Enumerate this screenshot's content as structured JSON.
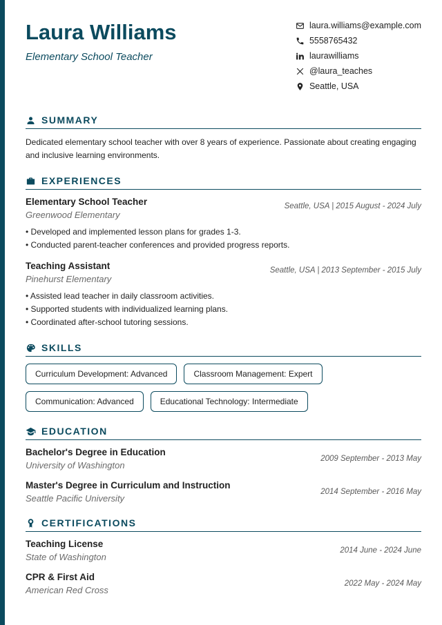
{
  "name": "Laura Williams",
  "title": "Elementary School Teacher",
  "contacts": {
    "email": "laura.williams@example.com",
    "phone": "5558765432",
    "linkedin": "laurawilliams",
    "twitter": "@laura_teaches",
    "location": "Seattle, USA"
  },
  "sections": {
    "summary": "SUMMARY",
    "experiences": "EXPERIENCES",
    "skills": "SKILLS",
    "education": "EDUCATION",
    "certifications": "CERTIFICATIONS"
  },
  "summary": "Dedicated elementary school teacher with over 8 years of experience. Passionate about creating engaging and inclusive learning environments.",
  "experiences": [
    {
      "title": "Elementary School Teacher",
      "org": "Greenwood Elementary",
      "meta": "Seattle, USA  |  2015 August - 2024 July",
      "bullets": [
        "• Developed and implemented lesson plans for grades 1-3.",
        "• Conducted parent-teacher conferences and provided progress reports."
      ]
    },
    {
      "title": "Teaching Assistant",
      "org": "Pinehurst Elementary",
      "meta": "Seattle, USA  |  2013 September - 2015 July",
      "bullets": [
        "• Assisted lead teacher in daily classroom activities.",
        "• Supported students with individualized learning plans.",
        "• Coordinated after-school tutoring sessions."
      ]
    }
  ],
  "skills": [
    "Curriculum Development: Advanced",
    "Classroom Management: Expert",
    "Communication: Advanced",
    "Educational Technology: Intermediate"
  ],
  "education": [
    {
      "degree": "Bachelor's Degree in Education",
      "school": "University of Washington",
      "meta": "2009 September - 2013 May"
    },
    {
      "degree": "Master's Degree in Curriculum and Instruction",
      "school": "Seattle Pacific University",
      "meta": "2014 September - 2016 May"
    }
  ],
  "certifications": [
    {
      "name": "Teaching License",
      "issuer": "State of Washington",
      "meta": "2014 June - 2024 June"
    },
    {
      "name": "CPR & First Aid",
      "issuer": "American Red Cross",
      "meta": "2022 May - 2024 May"
    }
  ]
}
